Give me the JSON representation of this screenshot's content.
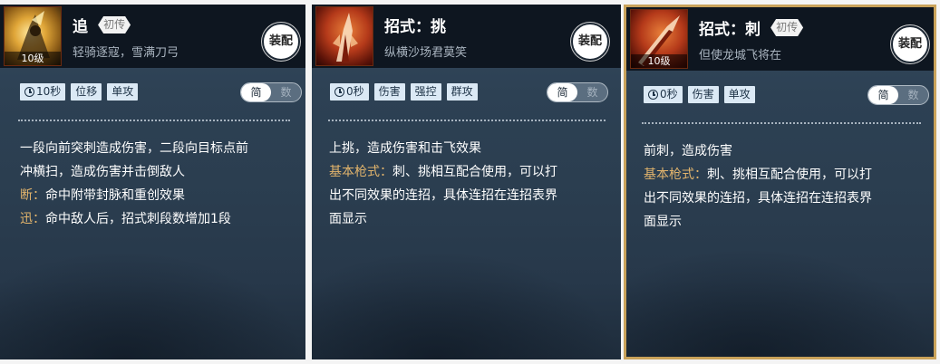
{
  "cards": [
    {
      "name": "追",
      "rank": "初传",
      "subtitle": "轻骑逐寇，雪满刀弓",
      "level": "10级",
      "equip_label": "装配",
      "tags": [
        "10秒",
        "位移",
        "单攻"
      ],
      "toggle": {
        "left": "简",
        "right": "数"
      },
      "desc": [
        {
          "kw": "",
          "text": "一段向前突刺造成伤害，二段向目标点前"
        },
        {
          "kw": "",
          "text": "冲横扫，造成伤害并击倒敌人"
        },
        {
          "kw": "断：",
          "text": "命中附带封脉和重创效果"
        },
        {
          "kw": "迅：",
          "text": "命中敌人后，招式刺段数增加1段"
        }
      ]
    },
    {
      "name": "招式：挑",
      "rank": "",
      "subtitle": "纵横沙场君莫笑",
      "level": "",
      "equip_label": "装配",
      "tags": [
        "0秒",
        "伤害",
        "强控",
        "群攻"
      ],
      "toggle": {
        "left": "简",
        "right": "数"
      },
      "desc": [
        {
          "kw": "",
          "text": "上挑，造成伤害和击飞效果"
        },
        {
          "kw": "基本枪式：",
          "text": "刺、挑相互配合使用，可以打"
        },
        {
          "kw": "",
          "text": "出不同效果的连招，具体连招在连招表界"
        },
        {
          "kw": "",
          "text": "面显示"
        }
      ]
    },
    {
      "name": "招式：刺",
      "rank": "初传",
      "subtitle": "但使龙城飞将在",
      "level": "10级",
      "equip_label": "装配",
      "tags": [
        "0秒",
        "伤害",
        "单攻"
      ],
      "toggle": {
        "left": "简",
        "right": "数"
      },
      "desc": [
        {
          "kw": "",
          "text": "前刺，造成伤害"
        },
        {
          "kw": "基本枪式：",
          "text": "刺、挑相互配合使用，可以打"
        },
        {
          "kw": "",
          "text": "出不同效果的连招，具体连招在连招表界"
        },
        {
          "kw": "",
          "text": "面显示"
        }
      ]
    }
  ]
}
